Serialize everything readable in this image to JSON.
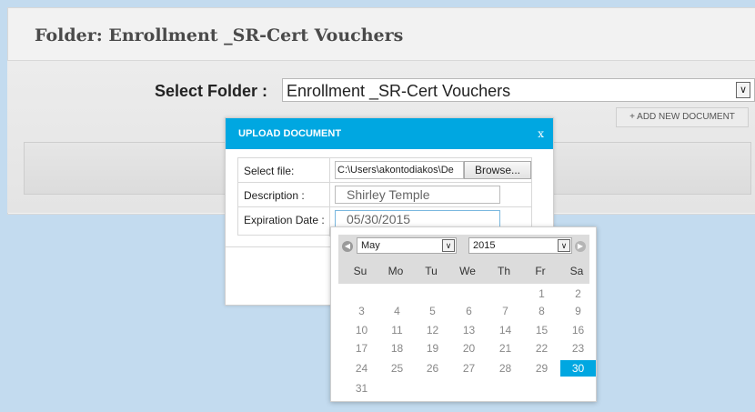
{
  "folder_title": "Folder: Enrollment _SR-Cert Vouchers",
  "select_folder": {
    "label": "Select Folder :",
    "value": "Enrollment _SR-Cert Vouchers"
  },
  "add_document_label": "+ ADD NEW DOCUMENT",
  "modal": {
    "title": "UPLOAD DOCUMENT",
    "close_label": "x",
    "select_file_label": "Select file:",
    "file_path": "C:\\Users\\akontodiakos\\De",
    "browse_label": "Browse...",
    "description_label": "Description :",
    "description_value": "Shirley Temple",
    "expiration_label": "Expiration Date :",
    "expiration_value": "05/30/2015"
  },
  "calendar": {
    "month": "May",
    "year": "2015",
    "weekdays": [
      "Su",
      "Mo",
      "Tu",
      "We",
      "Th",
      "Fr",
      "Sa"
    ],
    "weeks": [
      [
        "",
        "",
        "",
        "",
        "",
        "1",
        "2"
      ],
      [
        "3",
        "4",
        "5",
        "6",
        "7",
        "8",
        "9"
      ],
      [
        "10",
        "11",
        "12",
        "13",
        "14",
        "15",
        "16"
      ],
      [
        "17",
        "18",
        "19",
        "20",
        "21",
        "22",
        "23"
      ],
      [
        "24",
        "25",
        "26",
        "27",
        "28",
        "29",
        "30"
      ],
      [
        "31",
        "",
        "",
        "",
        "",
        "",
        ""
      ]
    ],
    "selected_day": "30"
  },
  "colors": {
    "accent": "#00a7e1",
    "page_bg": "#c3dbef"
  }
}
